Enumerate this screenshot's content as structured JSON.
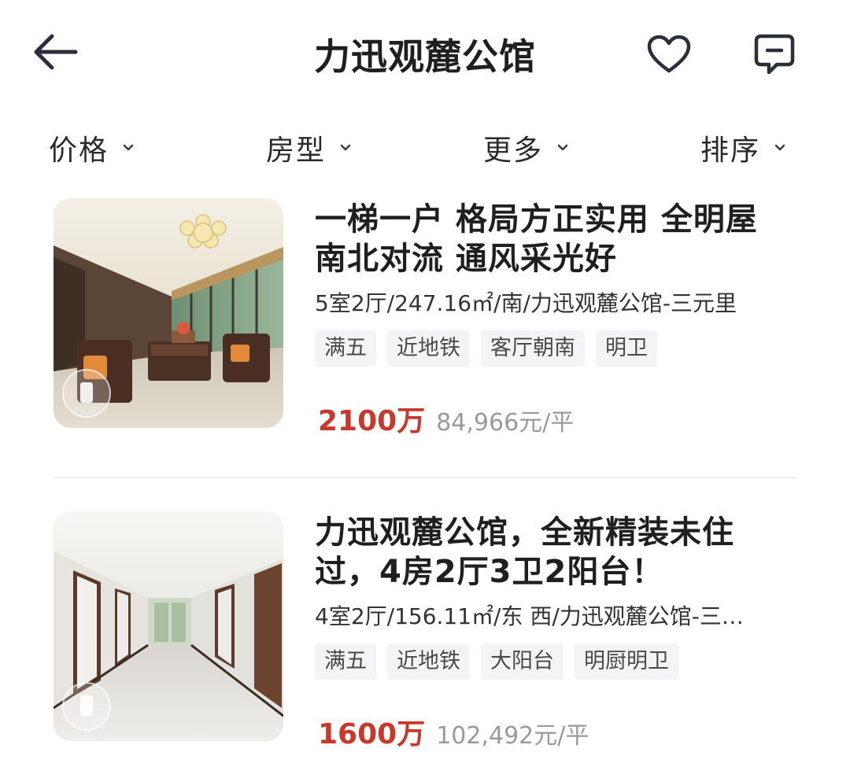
{
  "header": {
    "title": "力迅观麓公馆",
    "back_icon": "back-arrow-icon",
    "favorite_icon": "heart-icon",
    "message_icon": "chat-bubble-icon"
  },
  "filters": [
    {
      "label": "价格"
    },
    {
      "label": "房型"
    },
    {
      "label": "更多"
    },
    {
      "label": "排序"
    }
  ],
  "listings": [
    {
      "title": "一梯一户 格局方正实用 全明屋 南北对流 通风采光好",
      "meta": "5室2厅/247.16㎡/南/力迅观麓公馆-三元里",
      "tags": [
        "满五",
        "近地铁",
        "客厅朝南",
        "明卫"
      ],
      "price": "2100万",
      "unit_price": "84,966元/平"
    },
    {
      "title": "力迅观麓公馆，全新精装未住过，4房2厅3卫2阳台！",
      "meta": "4室2厅/156.11㎡/东 西/力迅观麓公馆-三…",
      "tags": [
        "满五",
        "近地铁",
        "大阳台",
        "明厨明卫"
      ],
      "price": "1600万",
      "unit_price": "102,492元/平"
    }
  ],
  "colors": {
    "price": "#c63a2e",
    "tag_bg": "#f3f4f6",
    "divider": "#eeeeee",
    "title_text": "#1f1f1f",
    "icon_stroke": "#2a2f3a"
  }
}
